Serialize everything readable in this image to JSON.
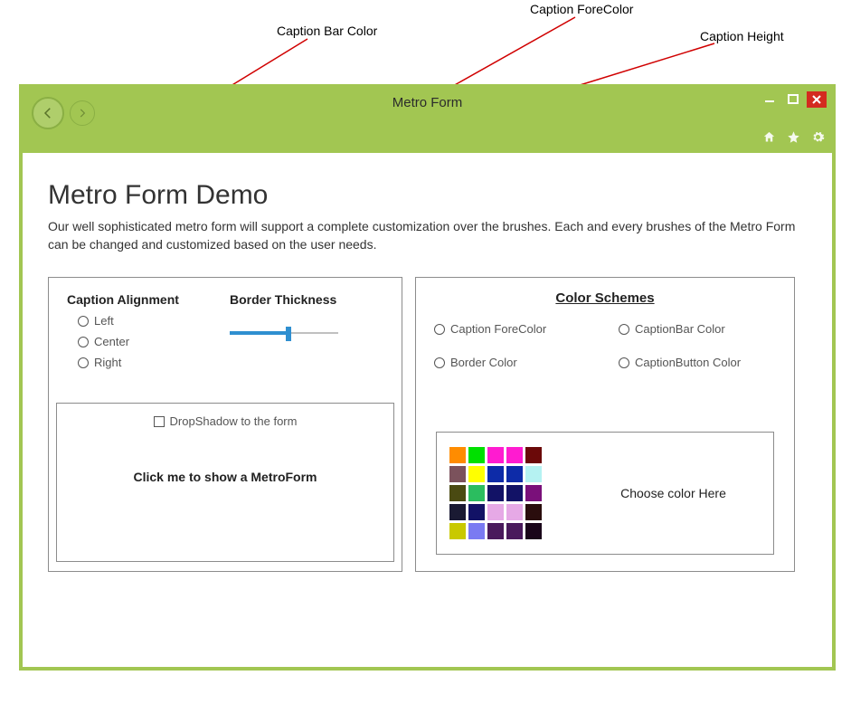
{
  "annotations": {
    "caption_bar_color": "Caption Bar Color",
    "caption_forecolor": "Caption ForeColor",
    "caption_height": "Caption Height"
  },
  "window": {
    "title": "Metro Form"
  },
  "page": {
    "title": "Metro Form Demo",
    "description": "Our well sophisticated metro form will support a complete customization over the brushes. Each and every brushes of the Metro Form can be changed and customized based on the user needs."
  },
  "left_panel": {
    "caption_alignment_label": "Caption Alignment",
    "alignment_options": [
      "Left",
      "Center",
      "Right"
    ],
    "border_thickness_label": "Border Thickness",
    "dropshadow_label": "DropShadow to the form",
    "click_me_label": "Click me to show a MetroForm"
  },
  "right_panel": {
    "title": "Color Schemes",
    "options": [
      "Caption ForeColor",
      "CaptionBar Color",
      "Border Color",
      "CaptionButton Color"
    ],
    "choose_label": "Choose color Here",
    "swatches": [
      "#ff8c00",
      "#00e000",
      "#ff1bd0",
      "#ff1bd0",
      "#6b0909",
      "#ffffff00",
      "#7b525c",
      "#ffff00",
      "#0d2ba8",
      "#0d2ba8",
      "#b5f2f2",
      "#ffffff00",
      "#4a4a12",
      "#2bbd5f",
      "#121266",
      "#121266",
      "#7a107a",
      "#ffffff00",
      "#1a1a33",
      "#121266",
      "#e6a9e6",
      "#e6a9e6",
      "#2a0d0d",
      "#ffffff00",
      "#c9c900",
      "#7a7af2",
      "#4a1a5c",
      "#4a1a5c",
      "#1a051a",
      "#ffffff00"
    ]
  },
  "colors": {
    "accent": "#a2c652",
    "close": "#d42b1f"
  }
}
